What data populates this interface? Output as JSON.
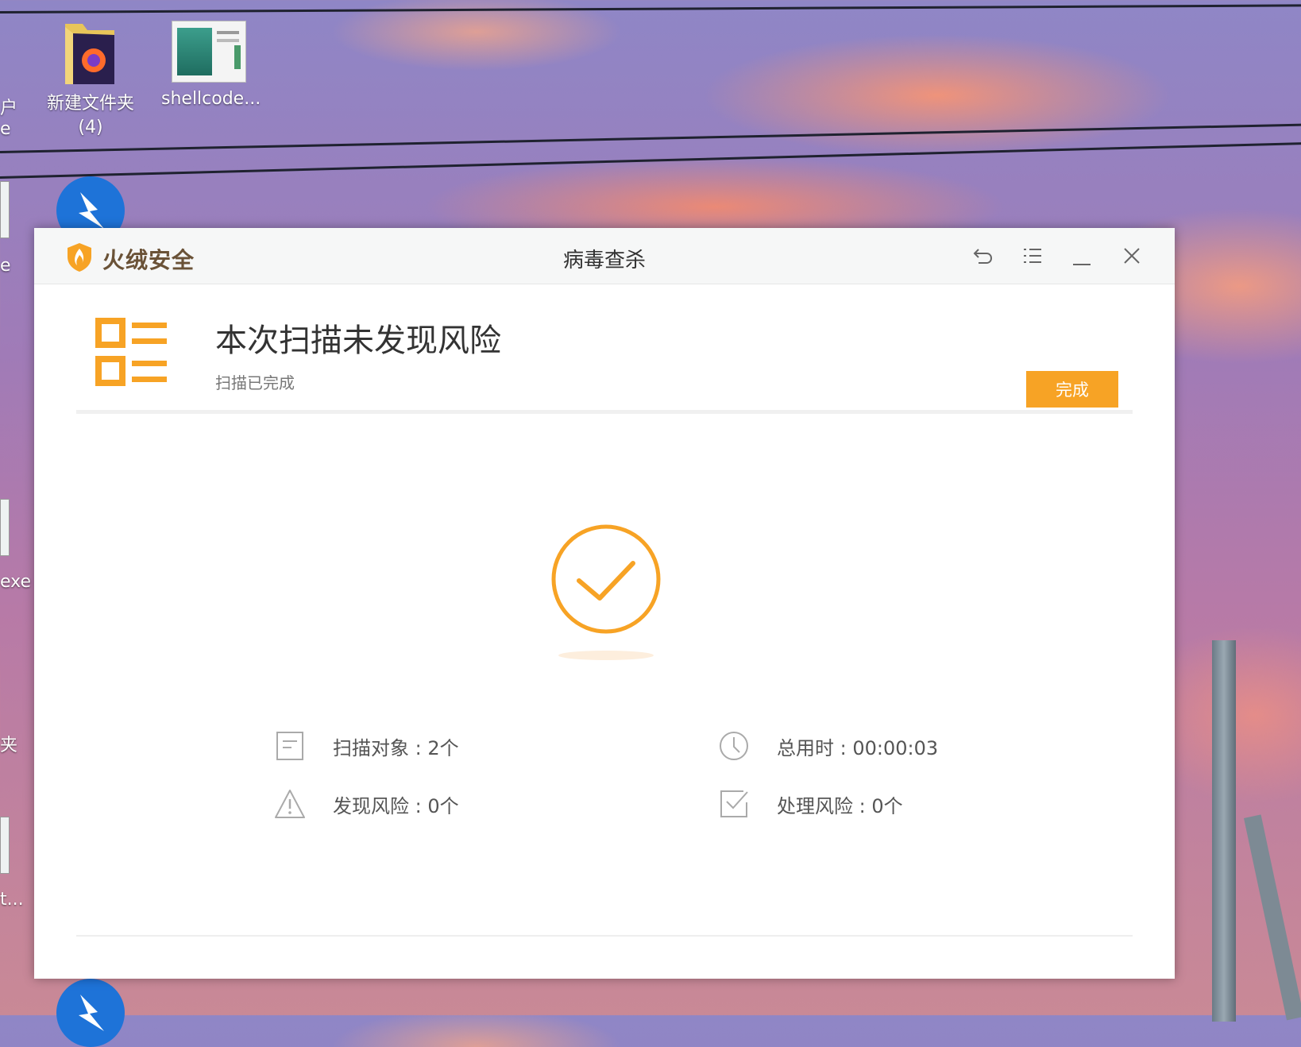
{
  "desktop": {
    "icons": [
      {
        "label_line1": "新建文件夹",
        "label_line2": "(4)"
      },
      {
        "label_line1": "shellcode..."
      }
    ],
    "edge_labels": [
      "户",
      "e",
      "e",
      "exe",
      "夹",
      "t..."
    ]
  },
  "app": {
    "brand": "火绒安全",
    "title": "病毒查杀",
    "controls": [
      "back-icon",
      "menu-icon",
      "minimize-icon",
      "close-icon"
    ]
  },
  "result": {
    "title": "本次扫描未发现风险",
    "subtitle": "扫描已完成",
    "done_button": "完成"
  },
  "stats": {
    "scanned": "扫描对象 : 2个",
    "elapsed": "总用时 : 00:00:03",
    "found": "发现风险 : 0个",
    "handled": "处理风险 : 0个"
  },
  "colors": {
    "accent": "#f7a325",
    "brand_text": "#6a5237"
  }
}
